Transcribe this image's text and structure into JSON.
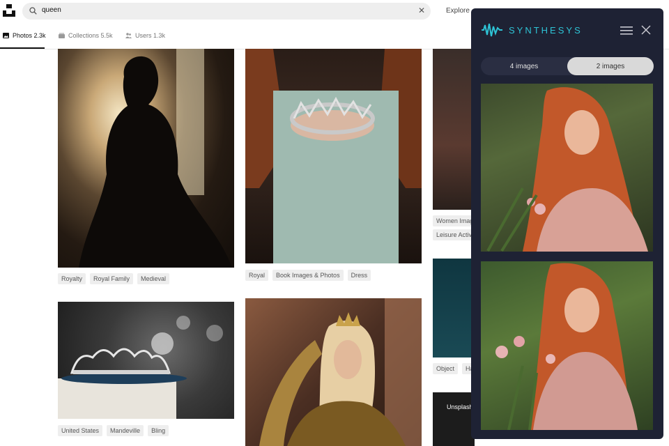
{
  "search": {
    "query": "queen"
  },
  "header": {
    "explore_label": "Explore"
  },
  "tabs": [
    {
      "label": "Photos 2.3k",
      "icon": "photo-icon"
    },
    {
      "label": "Collections 5.5k",
      "icon": "collections-icon"
    },
    {
      "label": "Users 1.3k",
      "icon": "users-icon"
    }
  ],
  "photos": {
    "col1": [
      {
        "tags": [
          "Royalty",
          "Royal Family",
          "Medieval"
        ]
      },
      {
        "tags": [
          "United States",
          "Mandeville",
          "Bling"
        ]
      }
    ],
    "col2": [
      {
        "tags": [
          "Royal",
          "Book Images & Photos",
          "Dress"
        ]
      },
      {
        "tags": []
      }
    ],
    "col3": [
      {
        "tags": [
          "Women Imag",
          "Leisure Activ"
        ]
      },
      {
        "tags": [
          "Object",
          "Ha"
        ]
      },
      {
        "caption": "Unsplash"
      }
    ]
  },
  "panel": {
    "brand": "SYNTHESYS",
    "segments": [
      "4 images",
      "2 images"
    ],
    "selected_segment": "2 images",
    "accent_color": "#2ec4d6",
    "background_color": "#1e2234"
  }
}
